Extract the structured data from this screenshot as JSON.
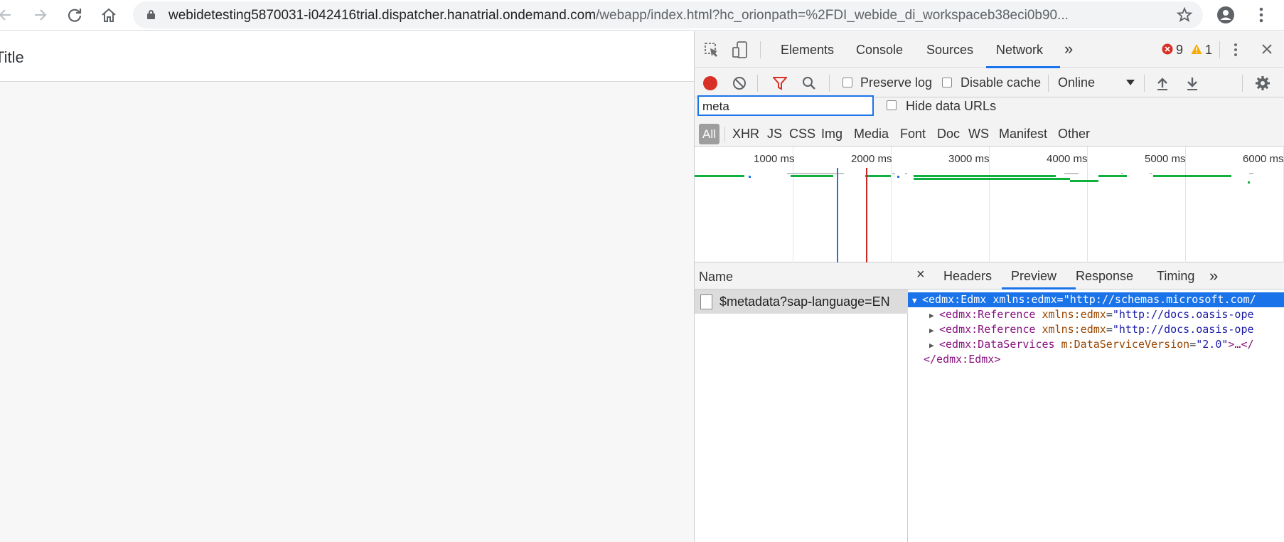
{
  "browser": {
    "url_host": "webidetesting5870031-i042416trial.dispatcher.hanatrial.ondemand.com",
    "url_path": "/webapp/index.html?hc_orionpath=%2FDI_webide_di_workspaceb38eci0b90...",
    "icons": [
      "back-arrow-icon",
      "forward-arrow-icon",
      "reload-icon",
      "home-icon",
      "lock-icon",
      "star-icon",
      "account-icon",
      "menu-dots-icon"
    ]
  },
  "page": {
    "title": "Title"
  },
  "devtools": {
    "tabs": [
      "Elements",
      "Console",
      "Sources",
      "Network"
    ],
    "active_tab": "Network",
    "more_tabs": "»",
    "error_count": "9",
    "warning_count": "1",
    "toolbar": {
      "preserve_log": "Preserve log",
      "disable_cache": "Disable cache",
      "throttling": "Online"
    },
    "filter": {
      "value": "meta",
      "hide_data_urls": "Hide data URLs"
    },
    "types": [
      "All",
      "XHR",
      "JS",
      "CSS",
      "Img",
      "Media",
      "Font",
      "Doc",
      "WS",
      "Manifest",
      "Other"
    ],
    "timeline_ticks": [
      "1000 ms",
      "2000 ms",
      "3000 ms",
      "4000 ms",
      "5000 ms",
      "6000 ms"
    ],
    "name_header": "Name",
    "request_name": "$metadata?sap-language=EN",
    "detail_tabs": [
      "Headers",
      "Preview",
      "Response",
      "Timing"
    ],
    "active_detail_tab": "Preview",
    "detail_more": "»",
    "detail_close": "×",
    "xml": {
      "line1_tag": "<edmx:Edmx",
      "line1_attr": "xmlns:edmx",
      "line1_val": "\"http://schemas.microsoft.com/",
      "line2_tag": "<edmx:Reference",
      "line2_attr": "xmlns:edmx",
      "line2_val": "\"http://docs.oasis-ope",
      "line3_tag": "<edmx:Reference",
      "line3_attr": "xmlns:edmx",
      "line3_val": "\"http://docs.oasis-ope",
      "line4_tag": "<edmx:DataServices",
      "line4_attr": "m:DataServiceVersion",
      "line4_val": "\"2.0\"",
      "line4_rest": ">…</",
      "line5": "</edmx:Edmx>"
    },
    "colors": {
      "accent": "#1a73e8",
      "record": "#d93025",
      "error": "#d93025",
      "warning": "#f9ab00",
      "timeline_green": "#0fb13e",
      "dom_loaded": "#1a73e8",
      "load_event": "#c62828"
    }
  }
}
